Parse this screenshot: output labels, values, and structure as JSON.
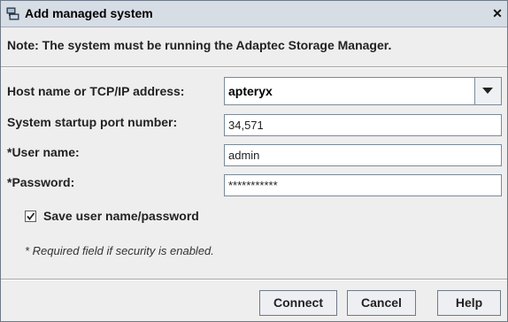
{
  "window": {
    "title": "Add managed system",
    "close_glyph": "✕"
  },
  "note": "Note: The system must be running the Adaptec Storage Manager.",
  "form": {
    "host": {
      "label": "Host name or TCP/IP address:",
      "value": "apteryx"
    },
    "port": {
      "label": "System startup port number:",
      "value": "34,571"
    },
    "user": {
      "label": "*User name:",
      "value": "admin"
    },
    "password": {
      "label": "*Password:",
      "value": "***********"
    }
  },
  "save_credentials": {
    "label": "Save user name/password",
    "checked": true
  },
  "required_hint": "* Required field if security is enabled.",
  "buttons": {
    "connect": "Connect",
    "cancel": "Cancel",
    "help": "Help"
  },
  "colors": {
    "titlebar": "#d7dde5",
    "dialog_bg": "#eeeeee"
  }
}
